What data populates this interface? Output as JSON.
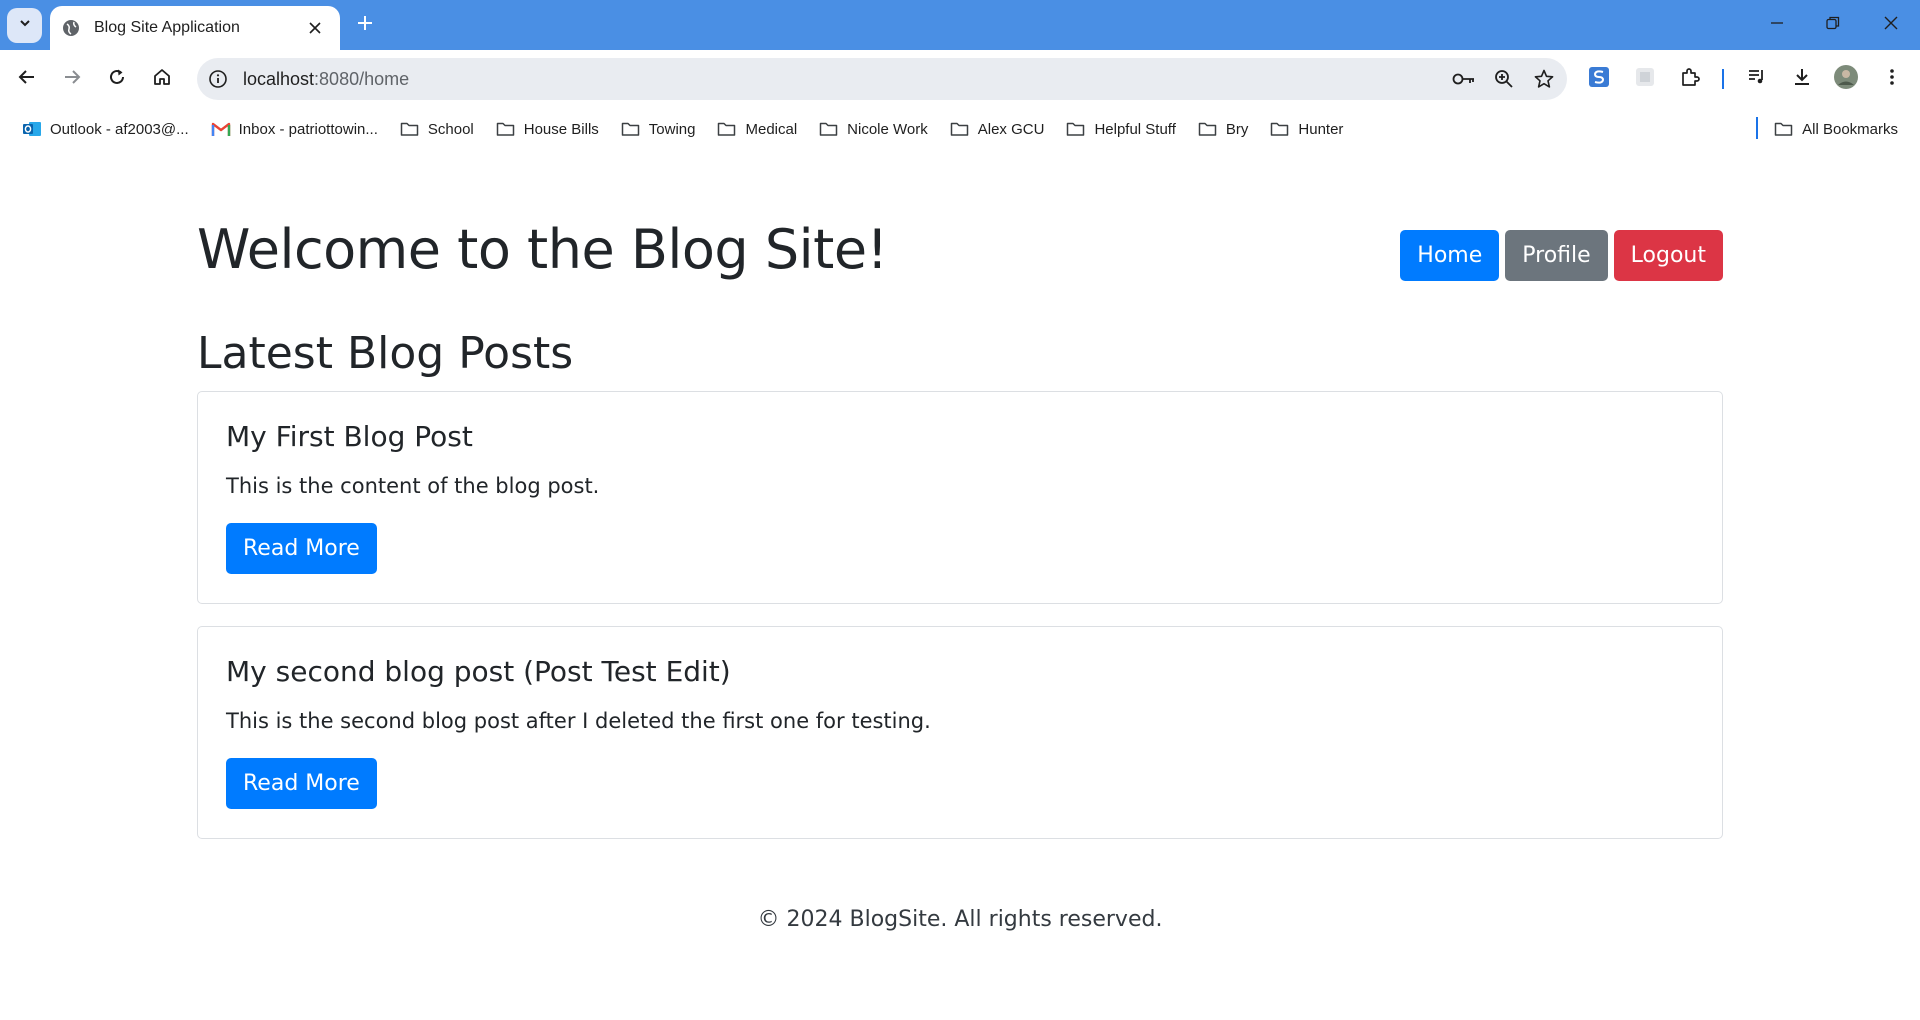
{
  "browser": {
    "tab": {
      "title": "Blog Site Application"
    },
    "address": {
      "host": "localhost",
      "path": ":8080/home"
    },
    "bookmarks": [
      {
        "label": "Outlook - af2003@...",
        "icon": "outlook-icon"
      },
      {
        "label": "Inbox - patriottowin...",
        "icon": "gmail-icon"
      },
      {
        "label": "School",
        "icon": "folder-icon"
      },
      {
        "label": "House Bills",
        "icon": "folder-icon"
      },
      {
        "label": "Towing",
        "icon": "folder-icon"
      },
      {
        "label": "Medical",
        "icon": "folder-icon"
      },
      {
        "label": "Nicole Work",
        "icon": "folder-icon"
      },
      {
        "label": "Alex GCU",
        "icon": "folder-icon"
      },
      {
        "label": "Helpful Stuff",
        "icon": "folder-icon"
      },
      {
        "label": "Bry",
        "icon": "folder-icon"
      },
      {
        "label": "Hunter",
        "icon": "folder-icon"
      }
    ],
    "all_bookmarks": "All Bookmarks",
    "colors": {
      "tabstrip": "#4a8fe4",
      "omnibox": "#e9ecf1"
    }
  },
  "page": {
    "title": "Welcome to the Blog Site!",
    "nav": {
      "home": "Home",
      "profile": "Profile",
      "logout": "Logout"
    },
    "section_title": "Latest Blog Posts",
    "posts": [
      {
        "title": "My First Blog Post",
        "content": "This is the content of the blog post.",
        "button": "Read More"
      },
      {
        "title": "My second blog post (Post Test Edit)",
        "content": "This is the second blog post after I deleted the first one for testing.",
        "button": "Read More"
      }
    ],
    "footer": "© 2024 BlogSite. All rights reserved.",
    "colors": {
      "primary": "#007bff",
      "secondary": "#6c757d",
      "danger": "#dc3545"
    }
  }
}
